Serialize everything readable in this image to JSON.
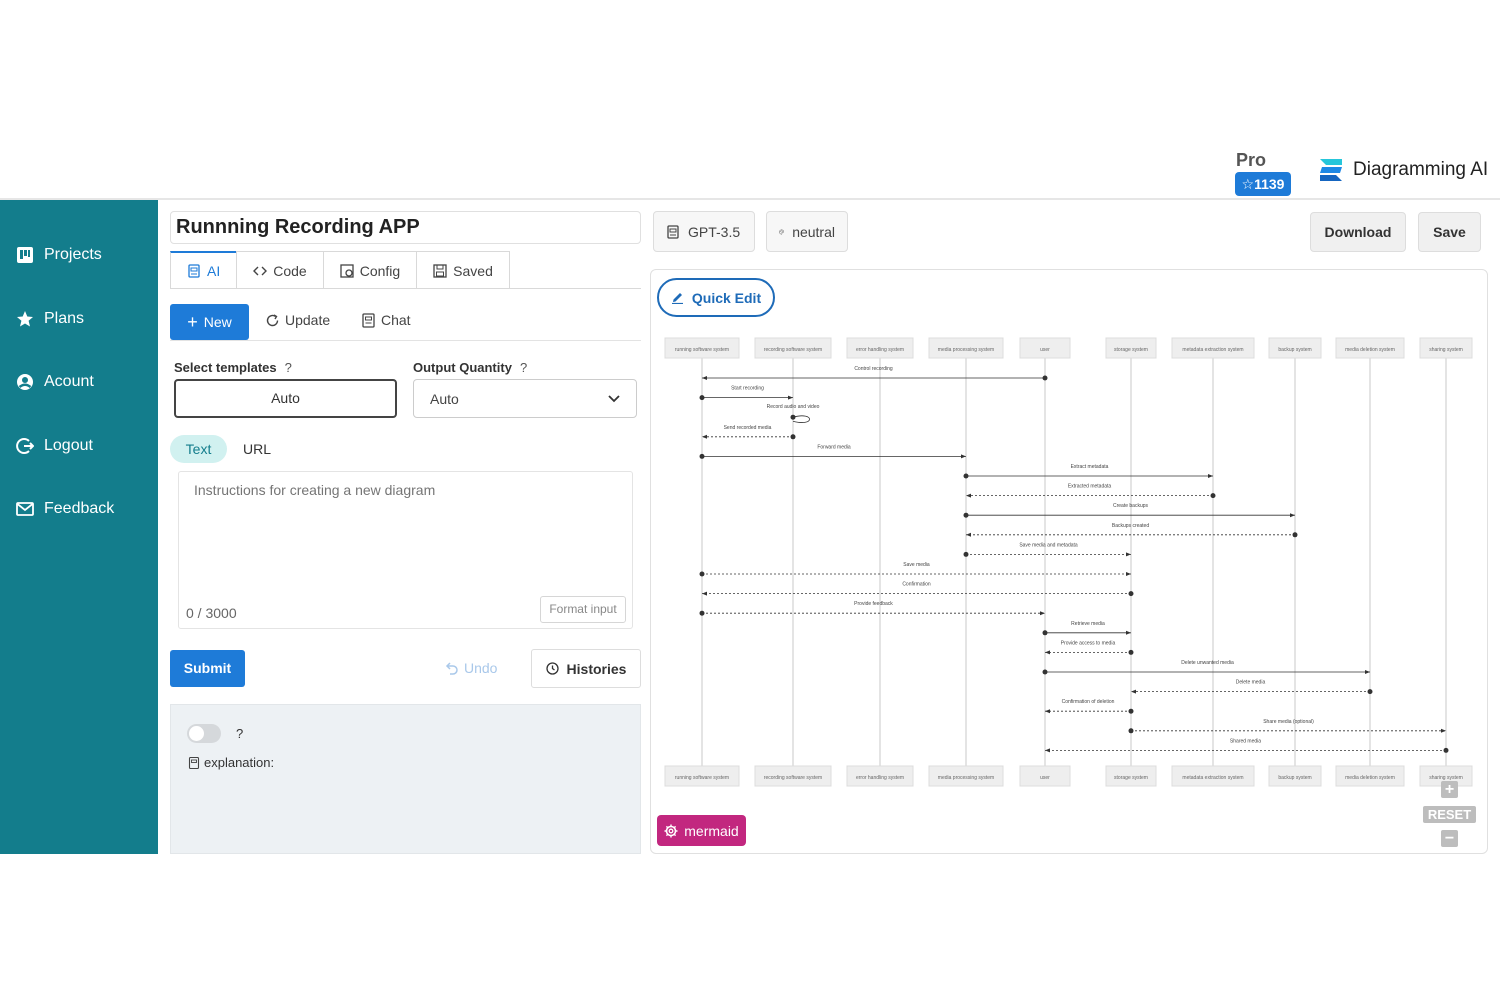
{
  "header": {
    "pro_label": "Pro",
    "star_count": "☆1139",
    "brand_name": "Diagramming AI"
  },
  "sidebar": {
    "items": [
      {
        "label": "Projects",
        "icon": "projects-icon"
      },
      {
        "label": "Plans",
        "icon": "star-icon"
      },
      {
        "label": "Acount",
        "icon": "user-icon"
      },
      {
        "label": "Logout",
        "icon": "logout-icon"
      },
      {
        "label": "Feedback",
        "icon": "mail-icon"
      }
    ],
    "color": "#137d8c"
  },
  "editor": {
    "title": "Runnning Recording APP",
    "tabs": [
      {
        "label": "AI",
        "active": true
      },
      {
        "label": "Code"
      },
      {
        "label": "Config"
      },
      {
        "label": "Saved"
      }
    ],
    "actions": {
      "new": "New",
      "update": "Update",
      "chat": "Chat"
    },
    "templates_label": "Select templates",
    "templates_value": "Auto",
    "quantity_label": "Output Quantity",
    "quantity_value": "Auto",
    "help_mark": "?",
    "input_tabs": {
      "text": "Text",
      "url": "URL"
    },
    "placeholder": "Instructions for creating a new diagram",
    "counter": "0 / 3000",
    "format_button": "Format input",
    "submit": "Submit",
    "undo": "Undo",
    "histories": "Histories",
    "toggle_help": "?",
    "explanation_label": "explanation:"
  },
  "toolbar": {
    "model": "GPT-3.5",
    "theme": "neutral",
    "download": "Download",
    "save": "Save"
  },
  "canvas": {
    "quick_edit": "Quick Edit",
    "mermaid": "mermaid",
    "reset": "RESET",
    "zoom_in": "+",
    "zoom_out": "−"
  },
  "diagram": {
    "participants": [
      "running software system",
      "recording software system",
      "error handling system",
      "media processing system",
      "user",
      "storage system",
      "metadata extraction system",
      "backup system",
      "media deletion system",
      "sharing system"
    ],
    "messages": [
      {
        "from": 4,
        "to": 0,
        "label": "Control recording",
        "dashed": false
      },
      {
        "from": 0,
        "to": 1,
        "label": "Start recording",
        "dashed": false
      },
      {
        "from": 1,
        "to": 1,
        "label": "Record audio and video",
        "dashed": false
      },
      {
        "from": 1,
        "to": 0,
        "label": "Send recorded media",
        "dashed": true
      },
      {
        "from": 0,
        "to": 3,
        "label": "Forward media",
        "dashed": false
      },
      {
        "from": 3,
        "to": 6,
        "label": "Extract metadata",
        "dashed": false
      },
      {
        "from": 6,
        "to": 3,
        "label": "Extracted metadata",
        "dashed": true
      },
      {
        "from": 3,
        "to": 7,
        "label": "Create backups",
        "dashed": false
      },
      {
        "from": 7,
        "to": 3,
        "label": "Backups created",
        "dashed": true
      },
      {
        "from": 3,
        "to": 5,
        "label": "Save media and metadata",
        "dashed": true
      },
      {
        "from": 0,
        "to": 5,
        "label": "Save media",
        "dashed": true
      },
      {
        "from": 5,
        "to": 0,
        "label": "Confirmation",
        "dashed": true
      },
      {
        "from": 0,
        "to": 4,
        "label": "Provide feedback",
        "dashed": true
      },
      {
        "from": 4,
        "to": 5,
        "label": "Retrieve media",
        "dashed": false
      },
      {
        "from": 5,
        "to": 4,
        "label": "Provide access to media",
        "dashed": true
      },
      {
        "from": 4,
        "to": 8,
        "label": "Delete unwanted media",
        "dashed": false
      },
      {
        "from": 8,
        "to": 5,
        "label": "Delete media",
        "dashed": true
      },
      {
        "from": 5,
        "to": 4,
        "label": "Confirmation of deletion",
        "dashed": true
      },
      {
        "from": 5,
        "to": 9,
        "label": "Share media (optional)",
        "dashed": true
      },
      {
        "from": 9,
        "to": 4,
        "label": "Shared media",
        "dashed": true
      }
    ]
  }
}
